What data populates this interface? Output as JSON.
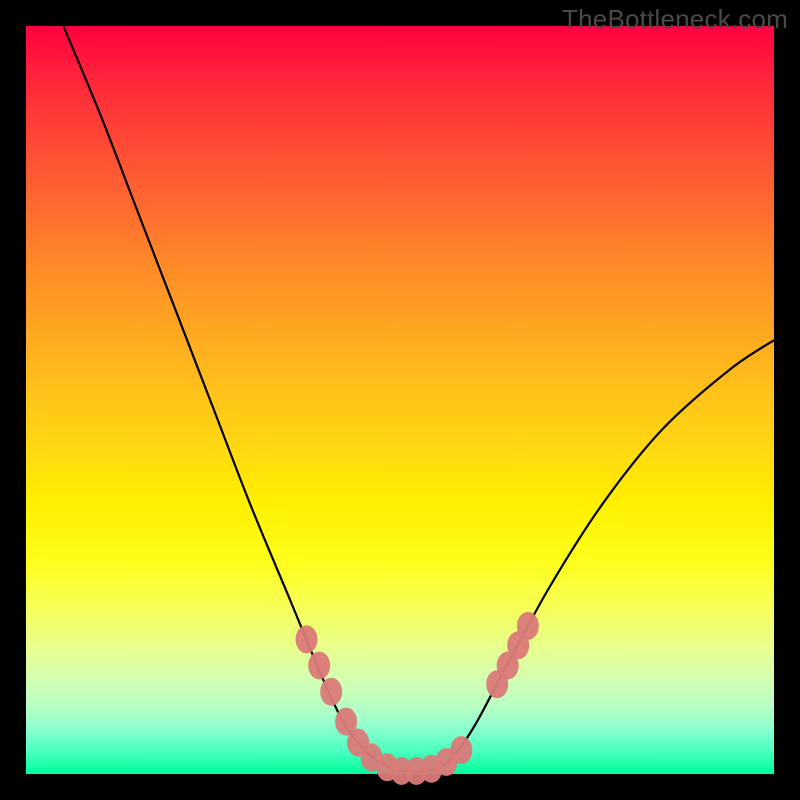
{
  "watermark": "TheBottleneck.com",
  "colors": {
    "curve_stroke": "#000000",
    "marker_fill": "#da7a78",
    "marker_stroke": "#da7a78"
  },
  "chart_data": {
    "type": "line",
    "title": "",
    "xlabel": "",
    "ylabel": "",
    "xlim": [
      0,
      100
    ],
    "ylim": [
      0,
      100
    ],
    "series": [
      {
        "name": "bottleneck-curve",
        "x": [
          5,
          10,
          15,
          20,
          25,
          30,
          35,
          40,
          43,
          46,
          49,
          52,
          55,
          57,
          60,
          64,
          70,
          77,
          85,
          94,
          100
        ],
        "y": [
          100,
          88,
          75,
          62,
          49,
          36,
          24,
          12,
          6,
          2.5,
          0.8,
          0.3,
          0.8,
          2.2,
          6.5,
          14,
          25,
          36,
          46,
          54,
          58
        ]
      }
    ],
    "markers": [
      {
        "name": "left-cluster",
        "points": [
          {
            "x": 37.5,
            "y": 18
          },
          {
            "x": 39.2,
            "y": 14.5
          },
          {
            "x": 40.8,
            "y": 11
          },
          {
            "x": 42.8,
            "y": 7.0
          },
          {
            "x": 44.4,
            "y": 4.2
          },
          {
            "x": 46.2,
            "y": 2.2
          }
        ]
      },
      {
        "name": "bottom-cluster",
        "points": [
          {
            "x": 48.3,
            "y": 0.9
          },
          {
            "x": 50.2,
            "y": 0.4
          },
          {
            "x": 52.2,
            "y": 0.4
          },
          {
            "x": 54.2,
            "y": 0.7
          },
          {
            "x": 56.2,
            "y": 1.6
          },
          {
            "x": 58.2,
            "y": 3.2
          }
        ]
      },
      {
        "name": "right-cluster",
        "points": [
          {
            "x": 63.0,
            "y": 12.0
          },
          {
            "x": 64.4,
            "y": 14.5
          },
          {
            "x": 65.8,
            "y": 17.2
          },
          {
            "x": 67.1,
            "y": 19.8
          }
        ]
      }
    ]
  }
}
